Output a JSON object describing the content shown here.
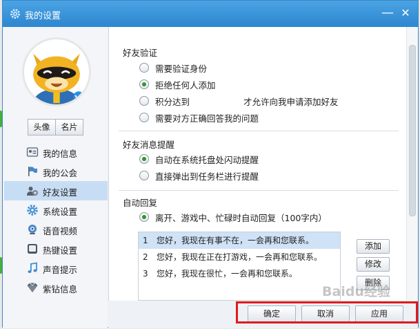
{
  "window": {
    "title": "我的设置",
    "minimize_glyph": "—",
    "close_glyph": "✕"
  },
  "profile": {
    "buttons": [
      "头像",
      "名片"
    ]
  },
  "nav": {
    "items": [
      {
        "label": "我的信息",
        "icon": "id-card-icon",
        "active": false
      },
      {
        "label": "我的公会",
        "icon": "flag-icon",
        "active": false
      },
      {
        "label": "好友设置",
        "icon": "friends-icon",
        "active": true
      },
      {
        "label": "系统设置",
        "icon": "gear-icon",
        "active": false
      },
      {
        "label": "语音视频",
        "icon": "webcam-icon",
        "active": false
      },
      {
        "label": "热键设置",
        "icon": "keyboard-icon",
        "active": false
      },
      {
        "label": "声音提示",
        "icon": "music-note-icon",
        "active": false
      },
      {
        "label": "紫钻信息",
        "icon": "diamond-icon",
        "active": false
      }
    ]
  },
  "friend_verify": {
    "title": "好友验证",
    "opt_verify": "需要验证身份",
    "opt_reject": "拒绝任何人添加",
    "opt_points_prefix": "积分达到",
    "opt_points_suffix": "才允许向我申请添加好友",
    "points_value": "",
    "opt_question": "需要对方正确回答我的问题",
    "selected": "opt_reject"
  },
  "message_alert": {
    "title": "好友消息提醒",
    "opt_tray": "自动在系统托盘处闪动提醒",
    "opt_taskbar": "直接弹出到任务栏进行提醒",
    "selected": "opt_tray"
  },
  "auto_reply": {
    "title": "自动回复",
    "option": "离开、游戏中、忙碌时自动回复（100字内）",
    "messages": [
      {
        "num": "1",
        "text": "您好，我现在有事不在，一会再和您联系。"
      },
      {
        "num": "2",
        "text": "您好，我现在正在打游戏，一会再和您联系。"
      },
      {
        "num": "3",
        "text": "您好，我现在很忙，一会再和您联系。"
      }
    ],
    "selected_index": 0,
    "add_label": "添加",
    "edit_label": "修改",
    "delete_label": "删除"
  },
  "footer": {
    "ok_label": "确定",
    "cancel_label": "取消",
    "apply_label": "应用"
  },
  "colors": {
    "titlebar": "#2d86cf",
    "selected_radio": "#2c9a24",
    "highlight_box": "#e0191c"
  }
}
